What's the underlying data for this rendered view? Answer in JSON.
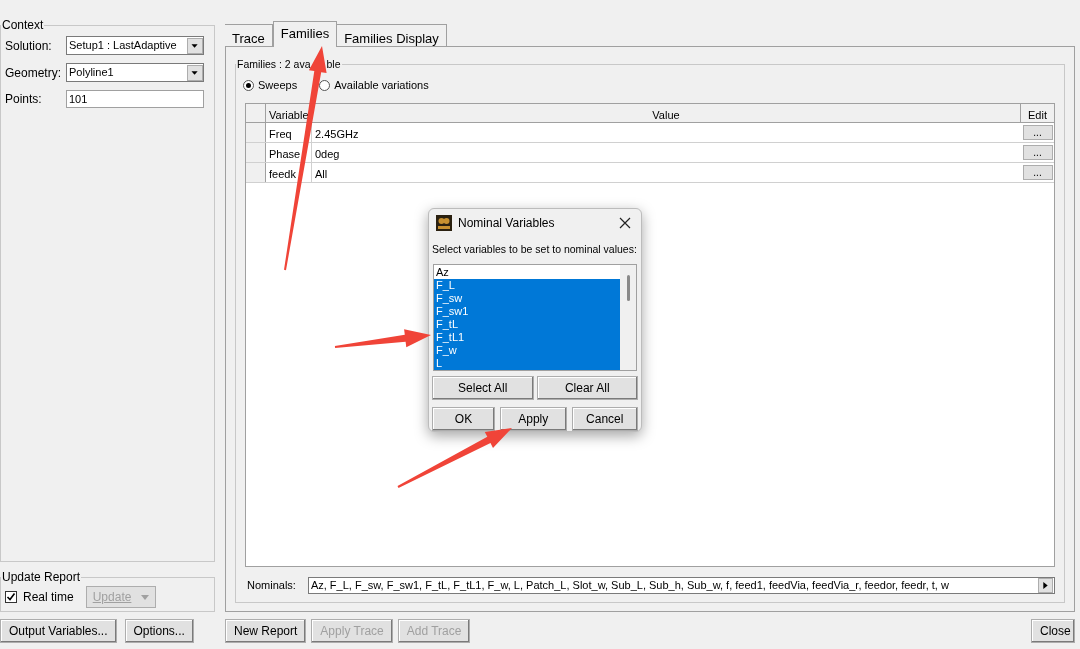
{
  "context": {
    "title": "Context",
    "fields": [
      {
        "label": "Solution:",
        "kind": "dropdown",
        "value": "Setup1 : LastAdaptive"
      },
      {
        "label": "Geometry:",
        "kind": "dropdown",
        "value": "Polyline1"
      },
      {
        "label": "Points:",
        "kind": "text",
        "value": "101"
      }
    ]
  },
  "update_report": {
    "title": "Update Report",
    "realtime": {
      "label": "Real time",
      "checked": true
    },
    "update_button": {
      "label": "Update",
      "disabled": true
    }
  },
  "left_buttons": [
    {
      "label": "Output Variables..."
    },
    {
      "label": "Options..."
    }
  ],
  "tabs": [
    {
      "label": "Trace",
      "selected": false
    },
    {
      "label": "Families",
      "selected": true
    },
    {
      "label": "Families Display",
      "selected": false
    }
  ],
  "families": {
    "title_parts": [
      "Families : 2 ava",
      "ble"
    ],
    "radios": [
      {
        "label": "Sweeps",
        "selected": true
      },
      {
        "label": "Available variations",
        "selected": false
      }
    ],
    "table": {
      "columns": [
        "Variable",
        "Value",
        "Edit"
      ],
      "rows": [
        {
          "variable": "Freq",
          "value": "2.45GHz",
          "edit": "..."
        },
        {
          "variable": "Phase",
          "value": "0deg",
          "edit": "..."
        },
        {
          "variable": "feedk",
          "value": "All",
          "edit": "..."
        }
      ]
    },
    "nominals": {
      "label": "Nominals:",
      "value": "Az, F_L, F_sw, F_sw1, F_tL, F_tL1, F_w, L, Patch_L, Slot_w, Sub_L, Sub_h, Sub_w, f, feed1, feedVia, feedVia_r, feedor, feedr, t, w"
    }
  },
  "bottom_buttons": [
    {
      "label": "New Report",
      "disabled": false
    },
    {
      "label": "Apply Trace",
      "disabled": true
    },
    {
      "label": "Add Trace",
      "disabled": true
    }
  ],
  "close_button": {
    "label": "Close",
    "disabled": false
  },
  "dialog": {
    "title": "Nominal Variables",
    "prompt": "Select variables to be set to nominal values:",
    "items": [
      {
        "label": "Az",
        "selected": false
      },
      {
        "label": "F_L",
        "selected": true
      },
      {
        "label": "F_sw",
        "selected": true
      },
      {
        "label": "F_sw1",
        "selected": true
      },
      {
        "label": "F_tL",
        "selected": true
      },
      {
        "label": "F_tL1",
        "selected": true
      },
      {
        "label": "F_w",
        "selected": true
      },
      {
        "label": "L",
        "selected": true
      }
    ],
    "list_buttons": [
      "Select All",
      "Clear All"
    ],
    "buttons": [
      "OK",
      "Apply",
      "Cancel"
    ]
  }
}
